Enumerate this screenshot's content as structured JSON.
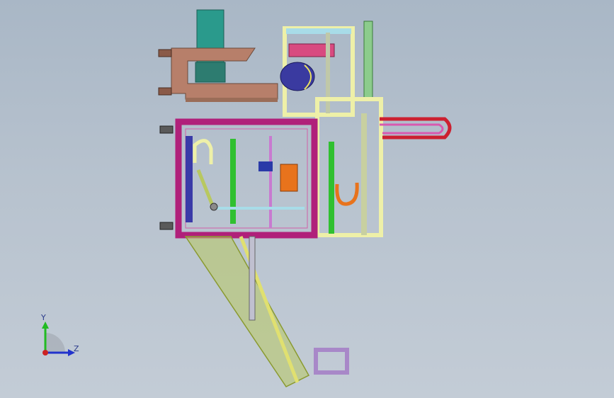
{
  "viewport": {
    "background_top": "#a9b7c6",
    "background_bottom": "#c3ccd6"
  },
  "triad": {
    "y_label": "Y",
    "z_label": "Z",
    "y_color": "#22bb22",
    "z_color": "#2233cc",
    "origin_color": "#cc2222"
  },
  "model": {
    "frame_magenta": "#b0207a",
    "frame_yellow": "#eef0a8",
    "bracket_brown": "#b77f6a",
    "cylinder_teal": "#2a9a8c",
    "motor_blue": "#3a3aa0",
    "accent_orange": "#e8731c",
    "accent_red": "#cc2030",
    "accent_green": "#30c030",
    "arm_olive": "#b8c860",
    "tray_purple": "#a888c8"
  }
}
